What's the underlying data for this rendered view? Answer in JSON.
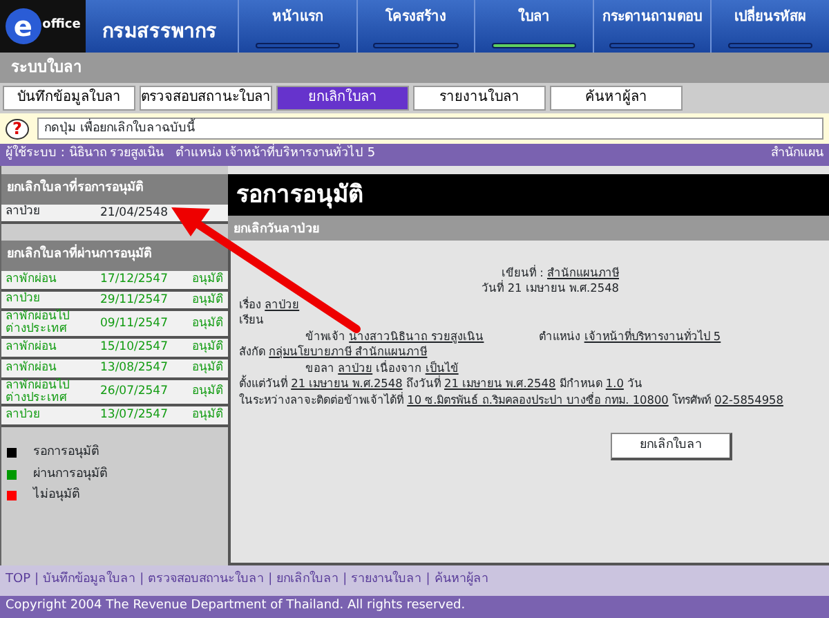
{
  "header": {
    "logo": {
      "letter": "e",
      "word": "office"
    },
    "org": "กรมสรรพากร",
    "nav": [
      {
        "label": "หน้าแรก",
        "selected": false
      },
      {
        "label": "โครงสร้าง",
        "selected": false
      },
      {
        "label": "ใบลา",
        "selected": true
      },
      {
        "label": "กระดานถามตอบ",
        "selected": false
      },
      {
        "label": "เปลี่ยนรหัสผ",
        "selected": false
      }
    ]
  },
  "system_title": "ระบบใบลา",
  "tabs": [
    {
      "label": "บันทึกข้อมูลใบลา",
      "selected": false
    },
    {
      "label": "ตรวจสอบสถานะใบลา",
      "selected": false
    },
    {
      "label": "ยกเลิกใบลา",
      "selected": true
    },
    {
      "label": "รายงานใบลา",
      "selected": false
    },
    {
      "label": "ค้นหาผู้ลา",
      "selected": false
    }
  ],
  "help": {
    "icon": "?",
    "text": "กดปุ่ม เพื่อยกเลิกใบลาฉบับนี้"
  },
  "user_bar": {
    "user": "ผู้ใช้ระบบ : นิธินาถ รวยสูงเนิน   ตำแหน่ง เจ้าหน้าที่บริหารงานทั่วไป 5",
    "office": "สำนักแผน"
  },
  "sidebar": {
    "sections": [
      {
        "title": "ยกเลิกใบลาที่รอการอนุมัติ",
        "kind": "pending",
        "rows": [
          {
            "type": "ลาป่วย",
            "date": "21/04/2548"
          }
        ]
      },
      {
        "title": "ยกเลิกใบลาที่ผ่านการอนุมัติ",
        "kind": "approved",
        "rows": [
          {
            "type": "ลาพักผ่อน",
            "date": "17/12/2547",
            "status": "อนุมัติ"
          },
          {
            "type": "ลาป่วย",
            "date": "29/11/2547",
            "status": "อนุมัติ"
          },
          {
            "type": "ลาพักผ่อนไปต่างประเทศ",
            "date": "09/11/2547",
            "status": "อนุมัติ"
          },
          {
            "type": "ลาพักผ่อน",
            "date": "15/10/2547",
            "status": "อนุมัติ"
          },
          {
            "type": "ลาพักผ่อน",
            "date": "13/08/2547",
            "status": "อนุมัติ"
          },
          {
            "type": "ลาพักผ่อนไปต่างประเทศ",
            "date": "26/07/2547",
            "status": "อนุมัติ"
          },
          {
            "type": "ลาป่วย",
            "date": "13/07/2547",
            "status": "อนุมัติ"
          }
        ]
      }
    ],
    "legend": [
      {
        "label": "รอการอนุมัติ",
        "color": "#000000"
      },
      {
        "label": "ผ่านการอนุมัติ",
        "color": "#009900"
      },
      {
        "label": "ไม่อนุมัติ",
        "color": "#ff0000"
      }
    ]
  },
  "main": {
    "title": "รอการอนุมัติ",
    "subtitle": "ยกเลิกวันลาป่วย",
    "letter": [
      {
        "indent": false,
        "groups": [
          [
            {
              "text": "เขียนที่ : ",
              "filled": false
            },
            {
              "text": "สำนักแผนภาษี",
              "filled": true
            }
          ]
        ]
      },
      {
        "indent": false,
        "groups": [
          [
            {
              "text": "วันที่ 21 เมษายน พ.ศ.2548",
              "filled": false
            }
          ]
        ]
      },
      {
        "indent": false,
        "groups": [
          [
            {
              "text": "เรื่อง ",
              "filled": false
            },
            {
              "text": "ลาป่วย",
              "filled": true
            }
          ]
        ]
      },
      {
        "indent": false,
        "groups": [
          [
            {
              "text": "เรียน",
              "filled": false
            }
          ]
        ]
      },
      {
        "indent": true,
        "groups": [
          [
            {
              "text": "ข้าพเจ้า ",
              "filled": false
            },
            {
              "text": "นางสาวนิธินาถ รวยสูงเนิน",
              "filled": true
            }
          ],
          [
            {
              "text": "ตำแหน่ง ",
              "filled": false
            },
            {
              "text": "เจ้าหน้าที่บริหารงานทั่วไป 5",
              "filled": true
            }
          ]
        ]
      },
      {
        "indent": false,
        "groups": [
          [
            {
              "text": "สังกัด ",
              "filled": false
            },
            {
              "text": "กลุ่มนโยบายภาษี สำนักแผนภาษี",
              "filled": true
            }
          ]
        ]
      },
      {
        "indent": true,
        "groups": [
          [
            {
              "text": "ขอลา ",
              "filled": false
            },
            {
              "text": "ลาป่วย",
              "filled": true
            },
            {
              "text": " เนื่องจาก ",
              "filled": false
            },
            {
              "text": "เป็นไข้",
              "filled": true
            }
          ]
        ]
      },
      {
        "indent": false,
        "groups": [
          [
            {
              "text": "ตั้งแต่วันที่ ",
              "filled": false
            },
            {
              "text": "21 เมษายน พ.ศ.2548",
              "filled": true
            },
            {
              "text": " ถึงวันที่ ",
              "filled": false
            },
            {
              "text": "21 เมษายน พ.ศ.2548",
              "filled": true
            },
            {
              "text": " มีกำหนด ",
              "filled": false
            },
            {
              "text": "1.0",
              "filled": true
            },
            {
              "text": " วัน",
              "filled": false
            }
          ]
        ]
      },
      {
        "indent": false,
        "groups": [
          [
            {
              "text": "ในระหว่างลาจะติดต่อข้าพเจ้าได้ที่ ",
              "filled": false
            },
            {
              "text": "10 ซ.มิตรพันธ์ ถ.ริมคลองประปา บางซื่อ กทม. 10800",
              "filled": true
            },
            {
              "text": " โทรศัพท์ ",
              "filled": false
            },
            {
              "text": "02-5854958",
              "filled": true
            }
          ]
        ]
      }
    ],
    "button": "ยกเลิกใบลา"
  },
  "footer": {
    "links": [
      "TOP",
      "บันทึกข้อมูลใบลา",
      "ตรวจสอบสถานะใบลา",
      "ยกเลิกใบลา",
      "รายงานใบลา",
      "ค้นหาผู้ลา"
    ],
    "separator": "|",
    "copyright": "Copyright 2004 The Revenue Department of Thailand. All rights reserved."
  }
}
